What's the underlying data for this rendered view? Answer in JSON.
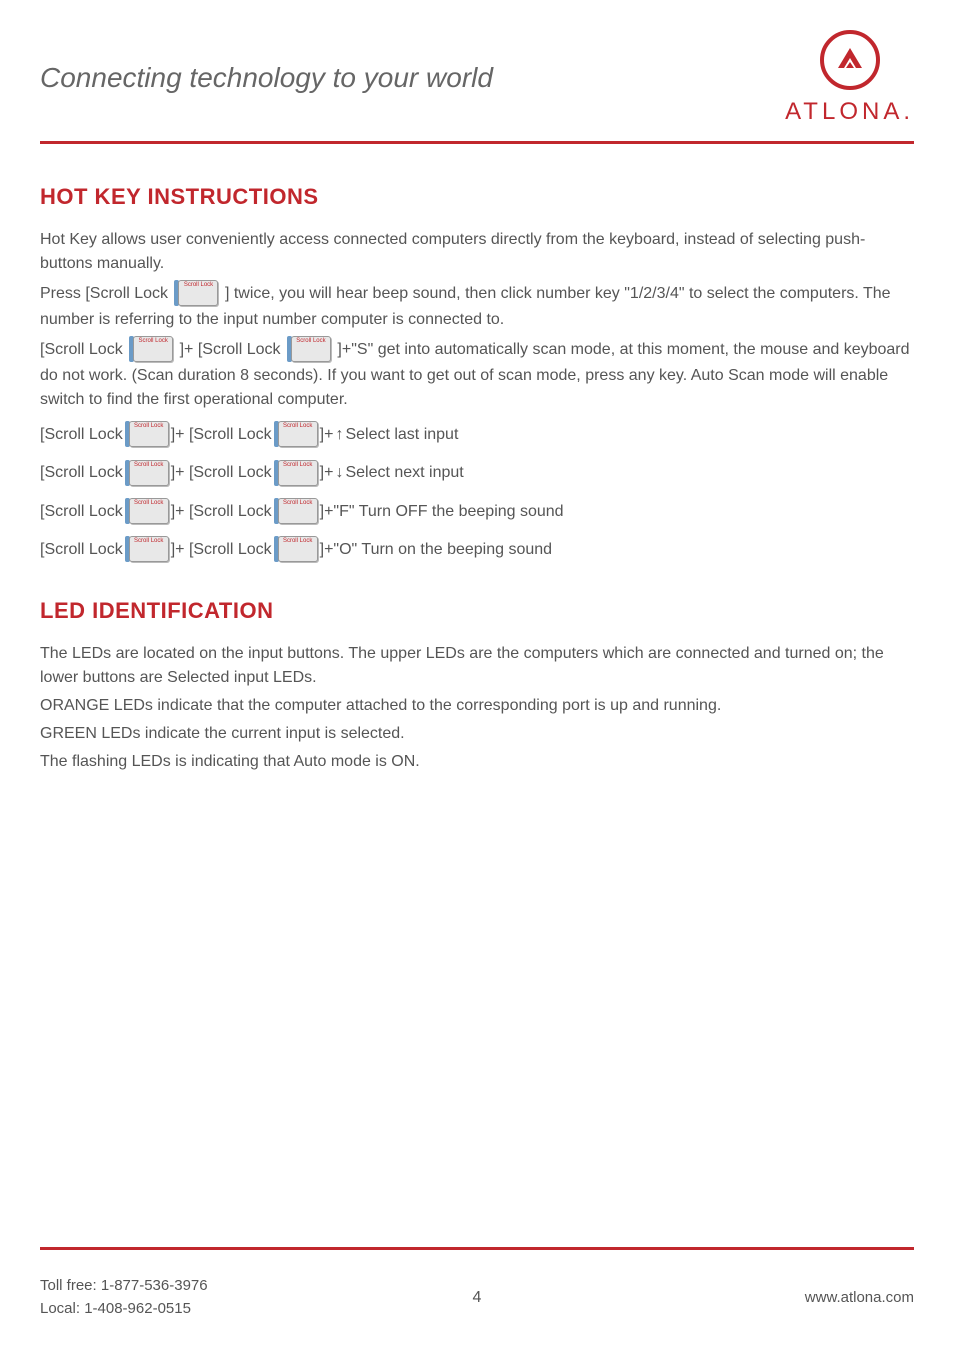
{
  "header": {
    "tagline": "Connecting technology to your world",
    "logo_text": "ATLONA",
    "logo_dot": "."
  },
  "sections": {
    "hotkey": {
      "title": "HOT KEY INSTRUCTIONS",
      "intro": "Hot Key allows user conveniently access connected computers directly from the keyboard, instead of selecting push-buttons manually.",
      "press_before": "Press [Scroll Lock ",
      "press_after": " ] twice, you will hear beep sound, then click number key \"1/2/3/4\" to select the computers. The number is referring to the input number computer is connected to.",
      "scan_part1": "[Scroll Lock ",
      "scan_part2": " ]+ [Scroll Lock ",
      "scan_part3": " ]+\"S\" get into automatically scan mode, at this moment, the mouse and keyboard do not work. (Scan duration 8 seconds). If you want to get out of scan mode, press any key. Auto Scan mode will enable switch to find the first operational computer.",
      "rows": [
        {
          "p1": "[Scroll Lock ",
          "p2": " ]+ [Scroll Lock ",
          "p3": " ]+ ",
          "arrow": "↑",
          "p4": " Select last input"
        },
        {
          "p1": "[Scroll Lock ",
          "p2": " ]+ [Scroll Lock ",
          "p3": " ]+ ",
          "arrow": "↓",
          "p4": " Select next input"
        },
        {
          "p1": "[Scroll Lock ",
          "p2": " ]+ [Scroll Lock ",
          "p3": " ]+\"F\" Turn OFF the beeping sound",
          "arrow": "",
          "p4": ""
        },
        {
          "p1": "[Scroll Lock ",
          "p2": " ]+ [Scroll Lock ",
          "p3": " ]+\"O\" Turn on the beeping sound",
          "arrow": "",
          "p4": ""
        }
      ],
      "key_label": "Scroll Lock"
    },
    "led": {
      "title": "LED IDENTIFICATION",
      "lines": [
        "The LEDs are located on the input buttons. The upper LEDs are the computers which are connected and turned on; the lower buttons are Selected input LEDs.",
        "ORANGE LEDs indicate that the computer attached to the corresponding port is up and running.",
        "GREEN LEDs indicate the current input is selected.",
        "The flashing LEDs is indicating that Auto mode is ON."
      ]
    }
  },
  "footer": {
    "toll_free": "Toll free: 1-877-536-3976",
    "local": "Local: 1-408-962-0515",
    "page_number": "4",
    "website": "www.atlona.com"
  }
}
